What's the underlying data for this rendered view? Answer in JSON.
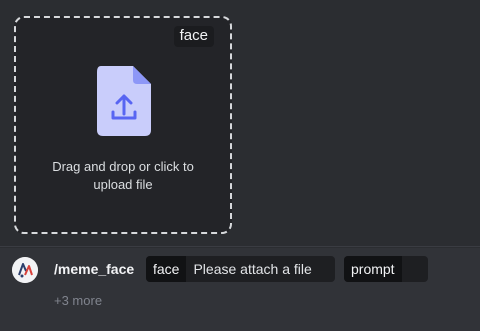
{
  "upload": {
    "option_name": "face",
    "instruction": "Drag and drop or click to\nupload file",
    "icon": "file-upload-icon"
  },
  "command": {
    "name": "/meme_face",
    "avatar_icon": "bot-avatar-icon",
    "options": [
      {
        "name": "face",
        "value": "Please attach a file"
      },
      {
        "name": "prompt",
        "value": ""
      }
    ],
    "more": "+3 more"
  },
  "colors": {
    "background": "#2b2d31",
    "dropzone": "#232428",
    "file_icon": "#c9cdfb",
    "file_icon_accent": "#5865f2"
  }
}
